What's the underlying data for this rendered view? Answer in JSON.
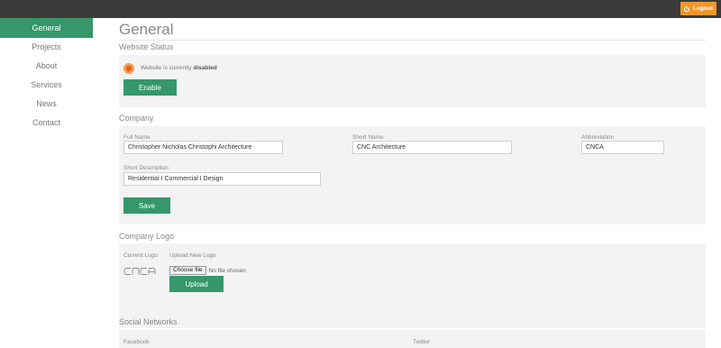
{
  "header": {
    "logout_label": "Logout"
  },
  "sidebar": {
    "items": [
      {
        "label": "General",
        "active": true
      },
      {
        "label": "Projects"
      },
      {
        "label": "About"
      },
      {
        "label": "Services"
      },
      {
        "label": "News"
      },
      {
        "label": "Contact"
      }
    ]
  },
  "main": {
    "title": "General",
    "website_status": {
      "title": "Website Status",
      "status_prefix": "Website is currently",
      "status_value": "disabled",
      "enable_label": "Enable"
    },
    "company": {
      "title": "Company",
      "full_name_label": "Full Name",
      "full_name_value": "Christopher Nicholas Christophi Architecture",
      "short_name_label": "Short Name",
      "short_name_value": "CNC Architecture",
      "abbreviation_label": "Abbreviation",
      "abbreviation_value": "CNCA",
      "short_description_label": "Short Description",
      "short_description_value": "Residential  I  Commercial  I  Design",
      "save_label": "Save"
    },
    "company_logo": {
      "title": "Company Logo",
      "current_logo_label": "Current Logo",
      "logo_text": "CNCA",
      "upload_label": "Upload New Logo",
      "choose_file_label": "Choose file",
      "no_file_text": "No file chosen",
      "upload_button_label": "Upload"
    },
    "social": {
      "title": "Social Networks",
      "facebook_label": "Facebook",
      "twitter_label": "Twitter"
    }
  },
  "colors": {
    "accent": "#35976a",
    "logout": "#f0962a",
    "topbar": "#3b3b3b",
    "status": "#f48a2c"
  }
}
